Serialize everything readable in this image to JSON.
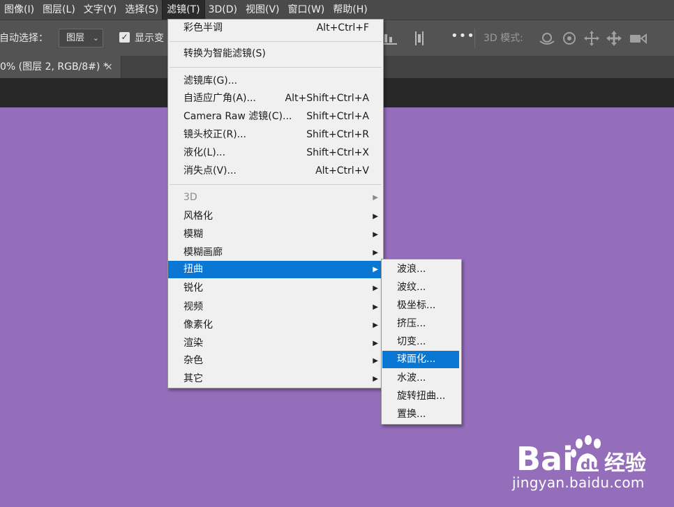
{
  "menubar": {
    "items": [
      {
        "label": "图像(I)"
      },
      {
        "label": "图层(L)"
      },
      {
        "label": "文字(Y)"
      },
      {
        "label": "选择(S)"
      },
      {
        "label": "滤镜(T)"
      },
      {
        "label": "3D(D)"
      },
      {
        "label": "视图(V)"
      },
      {
        "label": "窗口(W)"
      },
      {
        "label": "帮助(H)"
      }
    ]
  },
  "options": {
    "auto_select_label": "自动选择：",
    "auto_select_value": "图层",
    "show_transform_label": "显示变",
    "mode_3d_label": "3D 模式:"
  },
  "tab": {
    "title": "0% (图层 2, RGB/8#) *",
    "close": "×"
  },
  "filter_menu": {
    "items": [
      {
        "label": "彩色半调",
        "shortcut": "Alt+Ctrl+F"
      },
      {
        "label": "转换为智能滤镜(S)",
        "shortcut": ""
      },
      {
        "label": "滤镜库(G)...",
        "shortcut": ""
      },
      {
        "label": "自适应广角(A)...",
        "shortcut": "Alt+Shift+Ctrl+A"
      },
      {
        "label": "Camera Raw 滤镜(C)...",
        "shortcut": "Shift+Ctrl+A"
      },
      {
        "label": "镜头校正(R)...",
        "shortcut": "Shift+Ctrl+R"
      },
      {
        "label": "液化(L)...",
        "shortcut": "Shift+Ctrl+X"
      },
      {
        "label": "消失点(V)...",
        "shortcut": "Alt+Ctrl+V"
      },
      {
        "label": "3D",
        "shortcut": ""
      },
      {
        "label": "风格化",
        "shortcut": ""
      },
      {
        "label": "模糊",
        "shortcut": ""
      },
      {
        "label": "模糊画廊",
        "shortcut": ""
      },
      {
        "label": "扭曲",
        "shortcut": ""
      },
      {
        "label": "锐化",
        "shortcut": ""
      },
      {
        "label": "视频",
        "shortcut": ""
      },
      {
        "label": "像素化",
        "shortcut": ""
      },
      {
        "label": "渲染",
        "shortcut": ""
      },
      {
        "label": "杂色",
        "shortcut": ""
      },
      {
        "label": "其它",
        "shortcut": ""
      }
    ]
  },
  "distort_submenu": {
    "items": [
      {
        "label": "波浪..."
      },
      {
        "label": "波纹..."
      },
      {
        "label": "极坐标..."
      },
      {
        "label": "挤压..."
      },
      {
        "label": "切变..."
      },
      {
        "label": "球面化..."
      },
      {
        "label": "水波..."
      },
      {
        "label": "旋转扭曲..."
      },
      {
        "label": "置换..."
      }
    ]
  },
  "watermark": {
    "brand": "Baidu经验",
    "url": "jingyan.baidu.com"
  },
  "colors": {
    "canvas": "#946dbb",
    "highlight": "#0a77d5"
  }
}
